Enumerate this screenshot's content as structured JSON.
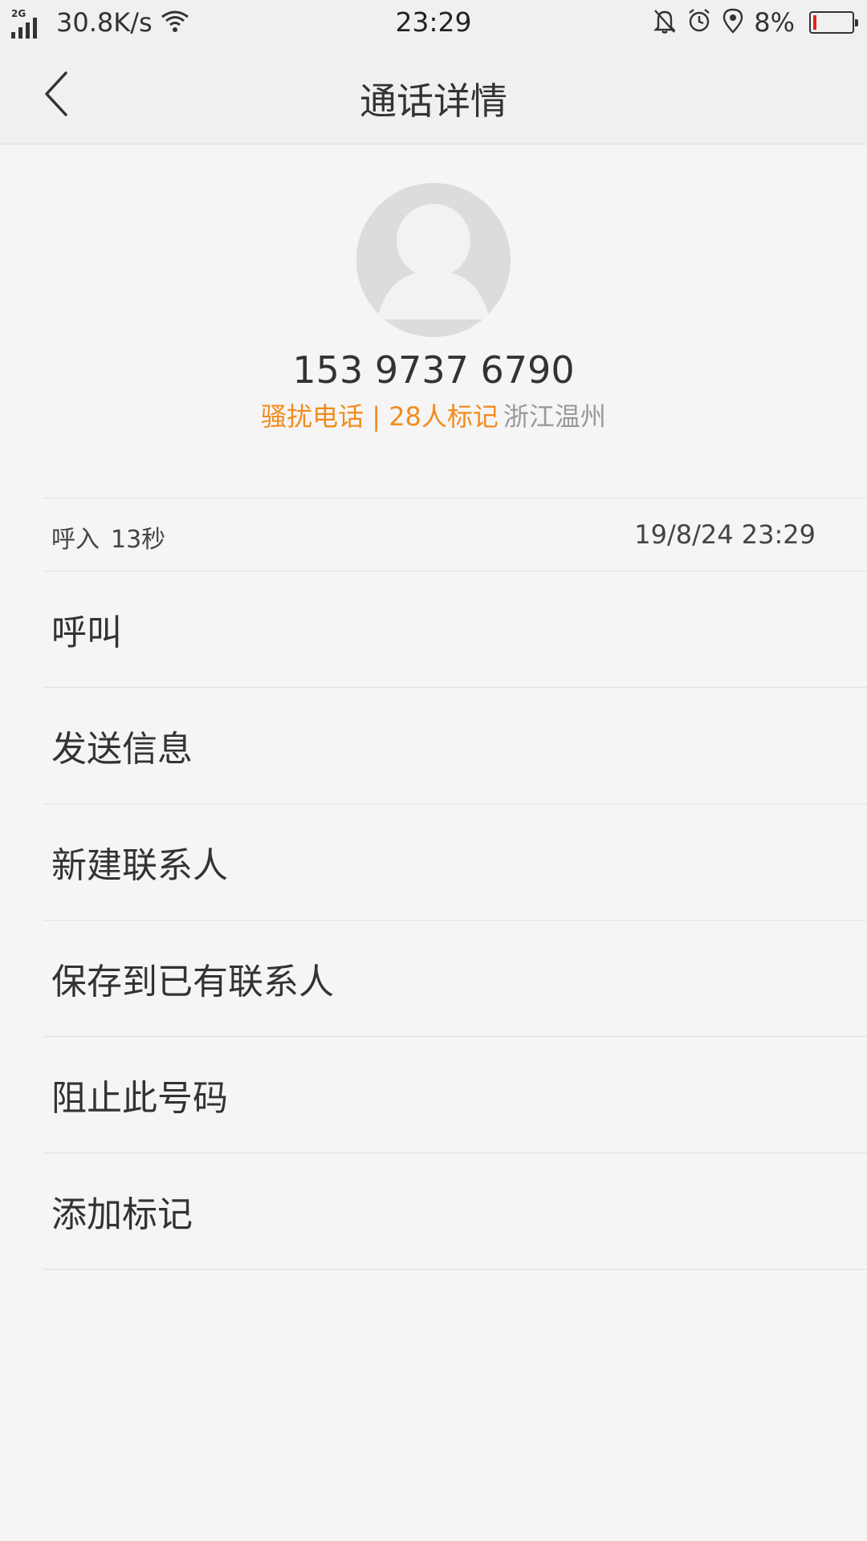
{
  "status_bar": {
    "network_type": "2G",
    "net_speed": "30.8K/s",
    "time": "23:29",
    "battery_percent": "8%",
    "battery_level": 0.08,
    "icons": [
      "signal-icon",
      "wifi-icon",
      "silent-bell-icon",
      "alarm-icon",
      "location-icon",
      "battery-icon"
    ],
    "battery_color": "#e82020"
  },
  "nav": {
    "back_icon": "chevron-left-icon",
    "title": "通话详情"
  },
  "contact": {
    "avatar_icon": "default-avatar-icon",
    "phone_number": "153 9737 6790",
    "tag_label": "骚扰电话 | 28人标记",
    "location": "浙江温州",
    "tag_color": "#f28c1c"
  },
  "call_record": {
    "direction": "呼入",
    "duration": "13秒",
    "timestamp": "19/8/24 23:29"
  },
  "actions": [
    {
      "label": "呼叫"
    },
    {
      "label": "发送信息"
    },
    {
      "label": "新建联系人"
    },
    {
      "label": "保存到已有联系人"
    },
    {
      "label": "阻止此号码"
    },
    {
      "label": "添加标记"
    }
  ]
}
